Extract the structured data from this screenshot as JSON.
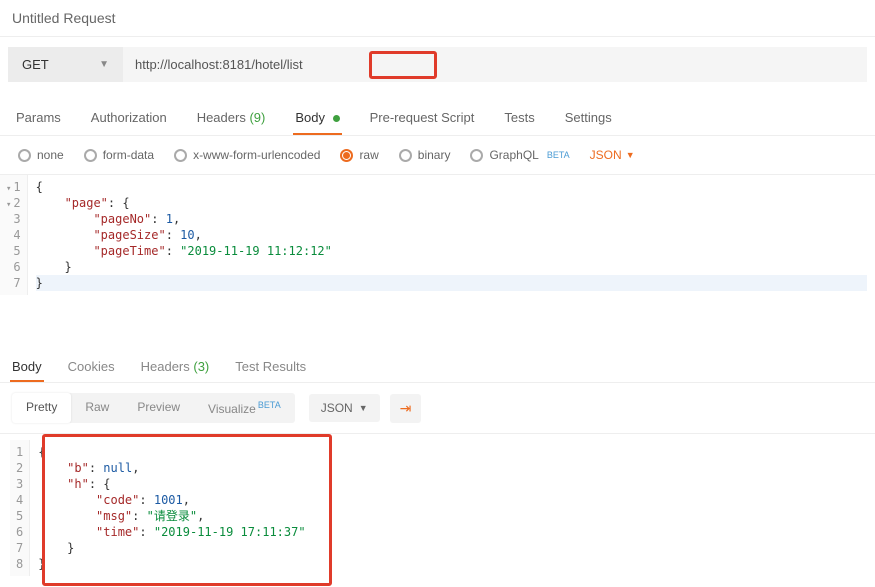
{
  "title": "Untitled Request",
  "request": {
    "method": "GET",
    "url": "http://localhost:8181/hotel/list"
  },
  "tabs": {
    "params": "Params",
    "authorization": "Authorization",
    "headers": "Headers",
    "headers_count": "(9)",
    "body": "Body",
    "prerequest": "Pre-request Script",
    "tests": "Tests",
    "settings": "Settings"
  },
  "body_types": {
    "none": "none",
    "formdata": "form-data",
    "urlencoded": "x-www-form-urlencoded",
    "raw": "raw",
    "binary": "binary",
    "graphql": "GraphQL",
    "beta": "BETA",
    "json_label": "JSON"
  },
  "request_body": {
    "lines": [
      "1",
      "2",
      "3",
      "4",
      "5",
      "6",
      "7"
    ],
    "page_key": "\"page\"",
    "pageNo_key": "\"pageNo\"",
    "pageNo_val": "1",
    "pageSize_key": "\"pageSize\"",
    "pageSize_val": "10",
    "pageTime_key": "\"pageTime\"",
    "pageTime_val": "\"2019-11-19 11:12:12\""
  },
  "response_tabs": {
    "body": "Body",
    "cookies": "Cookies",
    "headers": "Headers",
    "headers_count": "(3)",
    "results": "Test Results"
  },
  "view_modes": {
    "pretty": "Pretty",
    "raw": "Raw",
    "preview": "Preview",
    "visualize": "Visualize",
    "beta": "BETA",
    "format": "JSON"
  },
  "response_body": {
    "lines": [
      "1",
      "2",
      "3",
      "4",
      "5",
      "6",
      "7",
      "8"
    ],
    "b_key": "\"b\"",
    "b_val": "null",
    "h_key": "\"h\"",
    "code_key": "\"code\"",
    "code_val": "1001",
    "msg_key": "\"msg\"",
    "msg_val": "\"请登录\"",
    "time_key": "\"time\"",
    "time_val": "\"2019-11-19 17:11:37\""
  }
}
